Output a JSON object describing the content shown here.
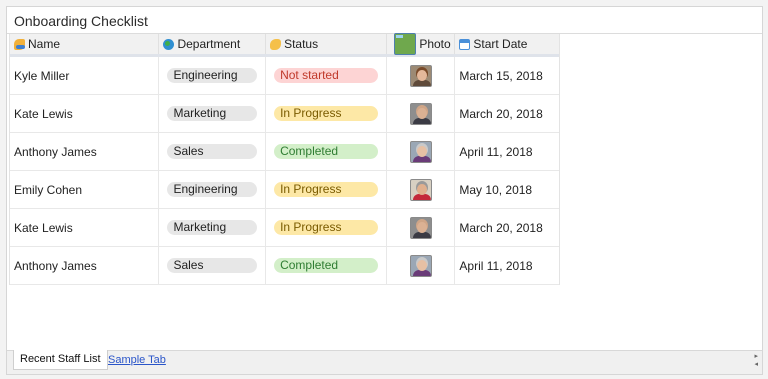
{
  "title": "Onboarding Checklist",
  "columns": {
    "name": "Name",
    "department": "Department",
    "status": "Status",
    "photo": "Photo",
    "start_date": "Start Date"
  },
  "status_colors": {
    "Not started": {
      "bg": "#fdd4d4",
      "fg": "#c0392b"
    },
    "In Progress": {
      "bg": "#fde8a6",
      "fg": "#7a5b00"
    },
    "Completed": {
      "bg": "#d3efc9",
      "fg": "#2f7d32"
    }
  },
  "rows": [
    {
      "name": "Kyle Miller",
      "department": "Engineering",
      "status": "Not started",
      "photo": "portrait-woman-brown-hair",
      "start_date": "March 15, 2018"
    },
    {
      "name": "Kate Lewis",
      "department": "Marketing",
      "status": "In Progress",
      "photo": "portrait-man-bald",
      "start_date": "March 20, 2018"
    },
    {
      "name": "Anthony James",
      "department": "Sales",
      "status": "Completed",
      "photo": "portrait-woman-purple-top",
      "start_date": "April 11, 2018"
    },
    {
      "name": "Emily Cohen",
      "department": "Engineering",
      "status": "In Progress",
      "photo": "portrait-man-red-shirt",
      "start_date": "May 10, 2018"
    },
    {
      "name": "Kate Lewis",
      "department": "Marketing",
      "status": "In Progress",
      "photo": "portrait-man-bald",
      "start_date": "March 20, 2018"
    },
    {
      "name": "Anthony James",
      "department": "Sales",
      "status": "Completed",
      "photo": "portrait-woman-purple-top",
      "start_date": "April 11, 2018"
    }
  ],
  "tabs": {
    "active": "Recent Staff List",
    "other": "Sample Tab"
  }
}
